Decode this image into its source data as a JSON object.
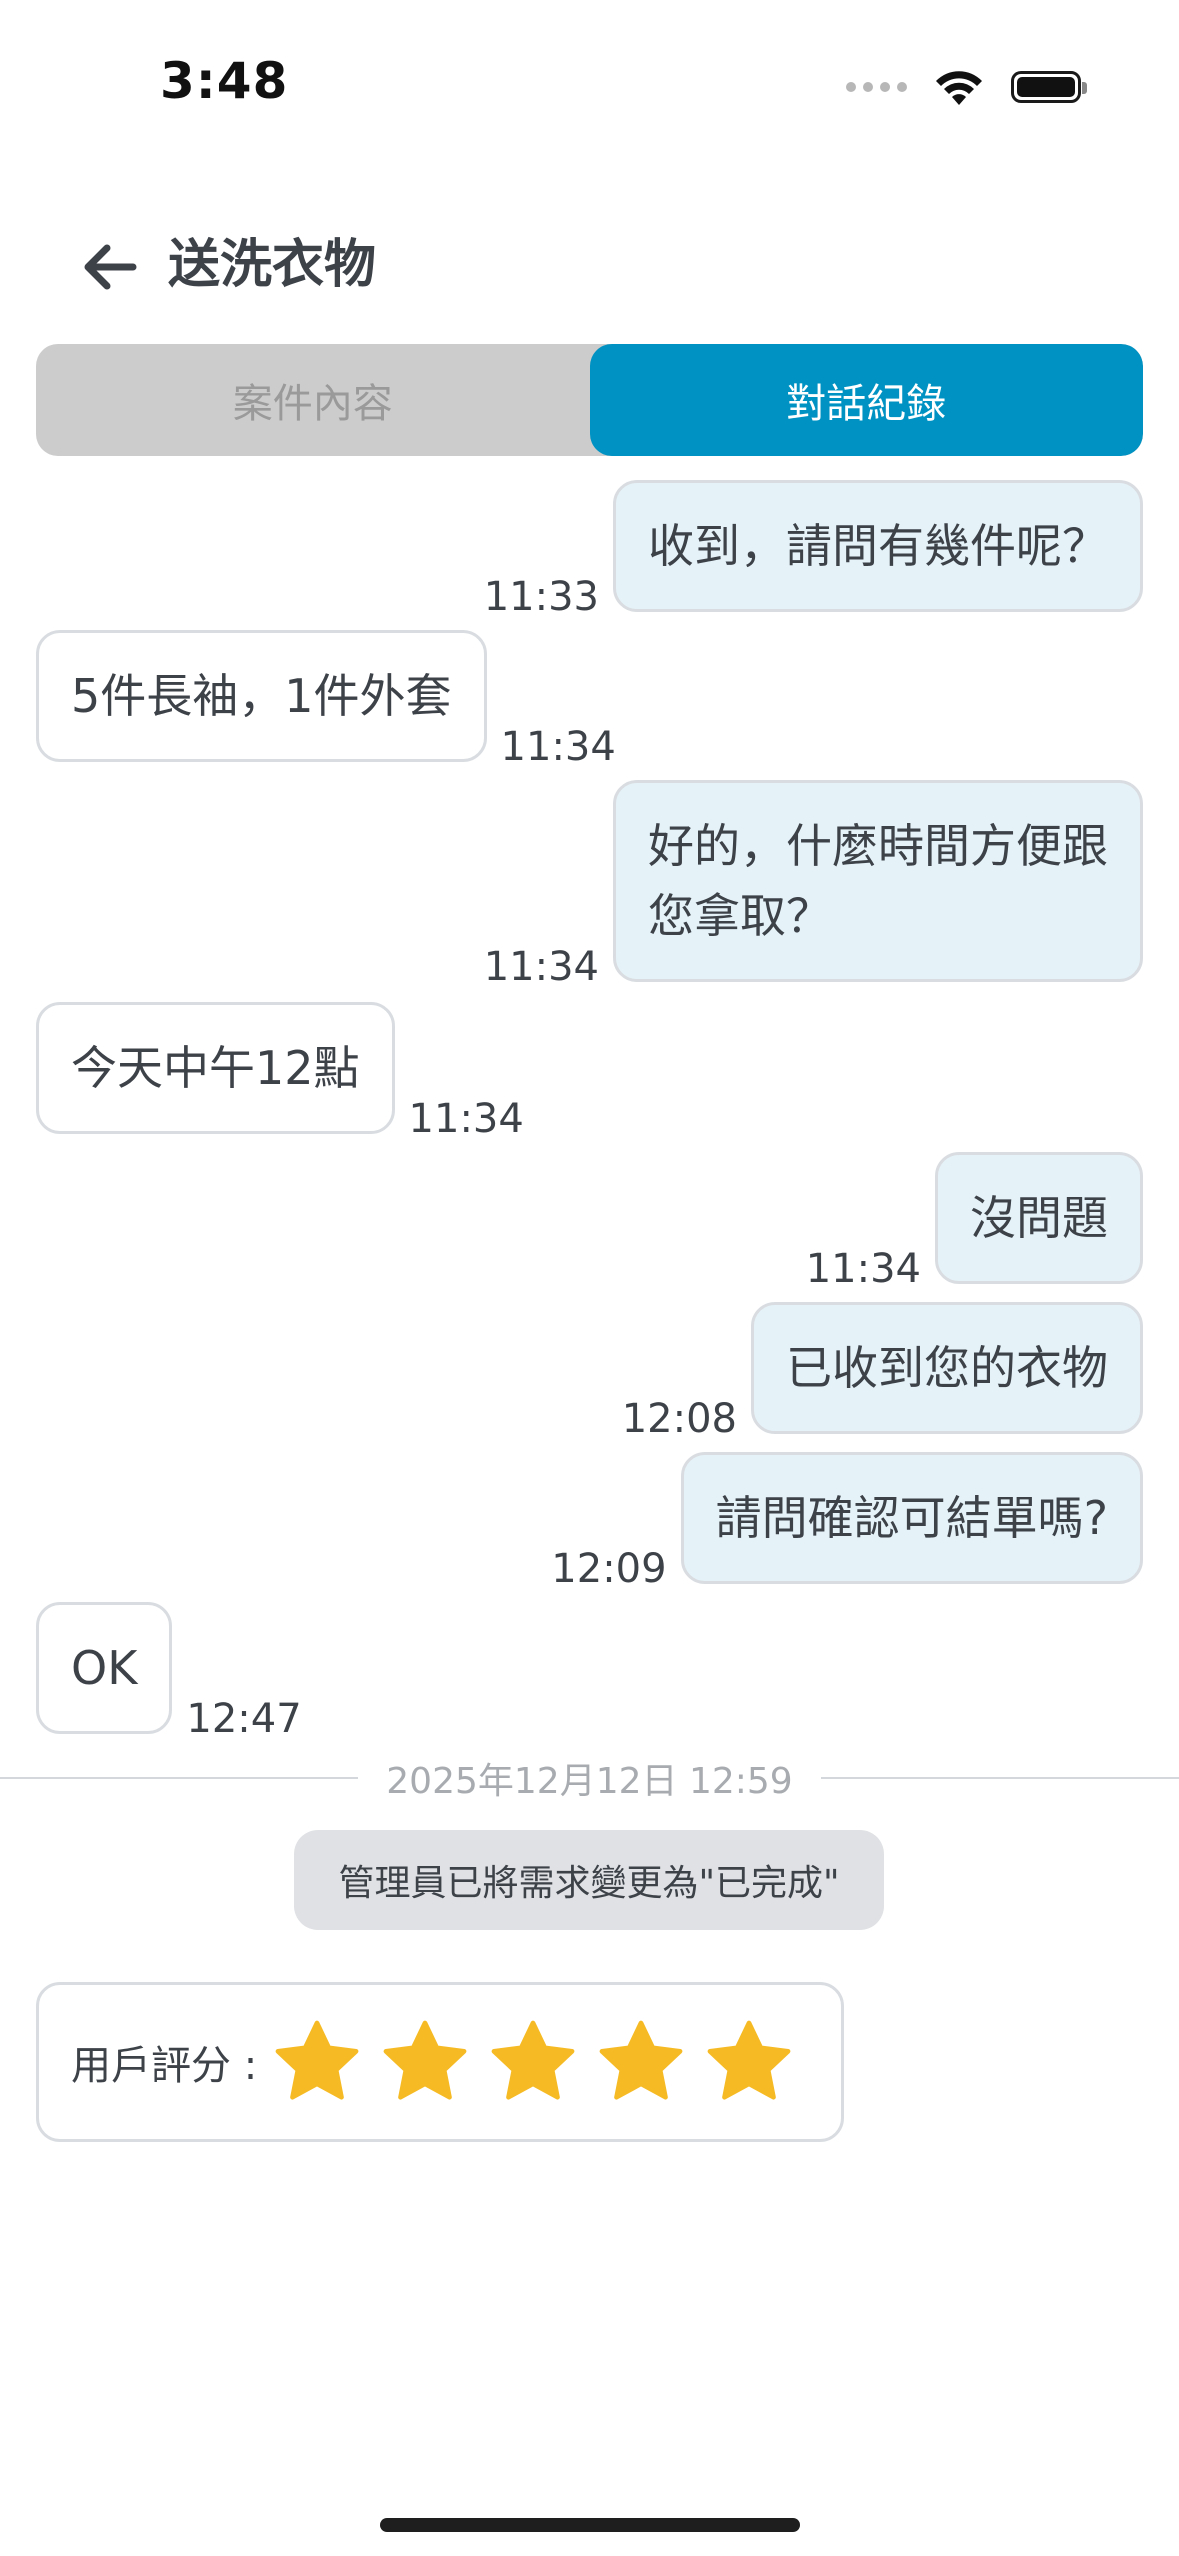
{
  "status_bar": {
    "time": "3:48",
    "wifi_icon": "wifi-icon",
    "battery_icon": "battery-icon"
  },
  "header": {
    "back_icon": "arrow-left-icon",
    "title": "送洗衣物"
  },
  "tabs": [
    {
      "label": "案件內容",
      "active": false
    },
    {
      "label": "對話紀錄",
      "active": true
    }
  ],
  "messages": [
    {
      "side": "right",
      "text": "收到，請問有幾件呢？",
      "time": "11:33"
    },
    {
      "side": "left",
      "text": "5件長袖，1件外套",
      "time": "11:34"
    },
    {
      "side": "right",
      "text": "好的，什麼時間方便跟\n您拿取？",
      "time": "11:34"
    },
    {
      "side": "left",
      "text": "今天中午12點",
      "time": "11:34"
    },
    {
      "side": "right",
      "text": "沒問題",
      "time": "11:34"
    },
    {
      "side": "right",
      "text": "已收到您的衣物",
      "time": "12:08"
    },
    {
      "side": "right",
      "text": "請問確認可結單嗎?",
      "time": "12:09"
    },
    {
      "side": "left",
      "text": "OK",
      "time": "12:47"
    }
  ],
  "divider_label": "2025年12月12日 12:59",
  "system_note": "管理員已將需求變更為\"已完成\"",
  "rating": {
    "label": "用戶評分 :",
    "stars": 5,
    "max_stars": 5,
    "star_color": "#f6bb24"
  },
  "colors": {
    "accent": "#0092c2",
    "sent_bubble": "#e5f3f9",
    "tab_inactive_bg": "#cccccc"
  }
}
